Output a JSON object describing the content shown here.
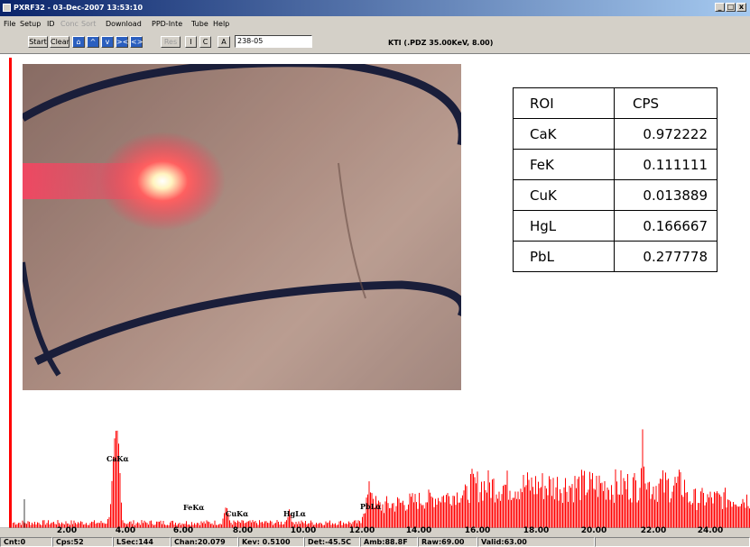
{
  "window": {
    "title": "PXRF32 - 03-Dec-2007 13:53:10",
    "min_glyph": "_",
    "max_glyph": "□",
    "close_glyph": "x"
  },
  "menu": [
    "File",
    "Setup",
    "ID",
    "Conc",
    "Sort",
    "Download",
    "PPD-Inte",
    "Tube",
    "Help"
  ],
  "menu_disabled": [
    "Conc",
    "Sort"
  ],
  "toolbar": {
    "start": "Start",
    "clear": "Clear",
    "res": "Res",
    "i": "I",
    "c": "C",
    "a": "A",
    "sample_id": "238-05",
    "kti_info": "KTI  (.PDZ 35.00KeV, 8.00)"
  },
  "roi_table": {
    "headers": [
      "ROI",
      "CPS"
    ],
    "rows": [
      [
        "CaK",
        "0.972222"
      ],
      [
        "FeK",
        "0.111111"
      ],
      [
        "CuK",
        "0.013889"
      ],
      [
        "HgL",
        "0.166667"
      ],
      [
        "PbL",
        "0.277778"
      ]
    ]
  },
  "spectrum": {
    "peak_labels": [
      "CaKα",
      "FeKα",
      "CuKα",
      "HgLα",
      "PbLα"
    ],
    "x_ticks": [
      "2.00",
      "4.00",
      "6.00",
      "8.00",
      "10.00",
      "12.00",
      "14.00",
      "16.00",
      "18.00",
      "20.00",
      "22.00",
      "24.00"
    ],
    "color": "#ff0000"
  },
  "status": {
    "cnt": "Cnt:0",
    "cps": "Cps:52",
    "lsec": "LSec:144",
    "chan": "Chan:20.079",
    "kev": "Kev: 0.5100",
    "det": "Det:-45.5C",
    "amb": "Amb:88.8F",
    "raw": "Raw:69.00",
    "valid": "Valid:63.00"
  }
}
